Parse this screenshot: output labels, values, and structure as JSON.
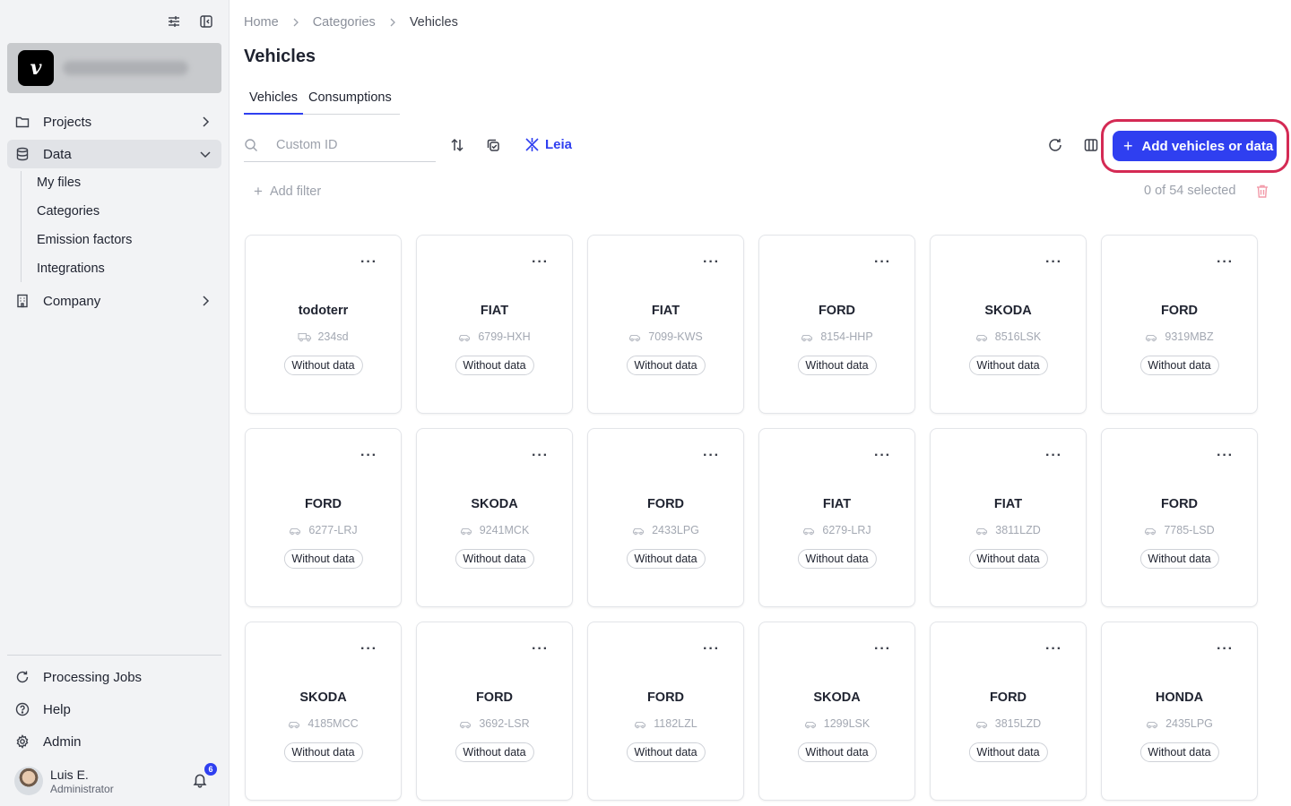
{
  "sidebar": {
    "nav": {
      "projects": "Projects",
      "data": "Data",
      "company": "Company"
    },
    "data_sub": [
      "My files",
      "Categories",
      "Emission factors",
      "Integrations"
    ],
    "bottom": {
      "processing_jobs": "Processing Jobs",
      "help": "Help",
      "admin": "Admin"
    },
    "user": {
      "name": "Luis E.",
      "role": "Administrator",
      "notifications": "6"
    }
  },
  "breadcrumb": [
    "Home",
    "Categories",
    "Vehicles"
  ],
  "page": {
    "title": "Vehicles",
    "tabs": [
      "Vehicles",
      "Consumptions"
    ],
    "active_tab": "Vehicles"
  },
  "toolbar": {
    "search_placeholder": "Custom ID",
    "leia_label": "Leia",
    "add_button": "Add vehicles or data",
    "add_filter": "Add filter",
    "selected_count": "0 of 54 selected"
  },
  "vehicles": [
    {
      "make": "todoterr",
      "plate": "234sd",
      "status": "Without data",
      "truck": true
    },
    {
      "make": "FIAT",
      "plate": "6799-HXH",
      "status": "Without data"
    },
    {
      "make": "FIAT",
      "plate": "7099-KWS",
      "status": "Without data"
    },
    {
      "make": "FORD",
      "plate": "8154-HHP",
      "status": "Without data"
    },
    {
      "make": "SKODA",
      "plate": "8516LSK",
      "status": "Without data"
    },
    {
      "make": "FORD",
      "plate": "9319MBZ",
      "status": "Without data"
    },
    {
      "make": "FORD",
      "plate": "6277-LRJ",
      "status": "Without data"
    },
    {
      "make": "SKODA",
      "plate": "9241MCK",
      "status": "Without data"
    },
    {
      "make": "FORD",
      "plate": "2433LPG",
      "status": "Without data"
    },
    {
      "make": "FIAT",
      "plate": "6279-LRJ",
      "status": "Without data"
    },
    {
      "make": "FIAT",
      "plate": "3811LZD",
      "status": "Without data"
    },
    {
      "make": "FORD",
      "plate": "7785-LSD",
      "status": "Without data"
    },
    {
      "make": "SKODA",
      "plate": "4185MCC",
      "status": "Without data"
    },
    {
      "make": "FORD",
      "plate": "3692-LSR",
      "status": "Without data"
    },
    {
      "make": "FORD",
      "plate": "1182LZL",
      "status": "Without data"
    },
    {
      "make": "SKODA",
      "plate": "1299LSK",
      "status": "Without data"
    },
    {
      "make": "FORD",
      "plate": "3815LZD",
      "status": "Without data"
    },
    {
      "make": "HONDA",
      "plate": "2435LPG",
      "status": "Without data"
    }
  ],
  "colors": {
    "accent": "#2f3ff0",
    "highlight_outline": "#d42a54",
    "sidebar_bg": "#f2f3f5"
  }
}
